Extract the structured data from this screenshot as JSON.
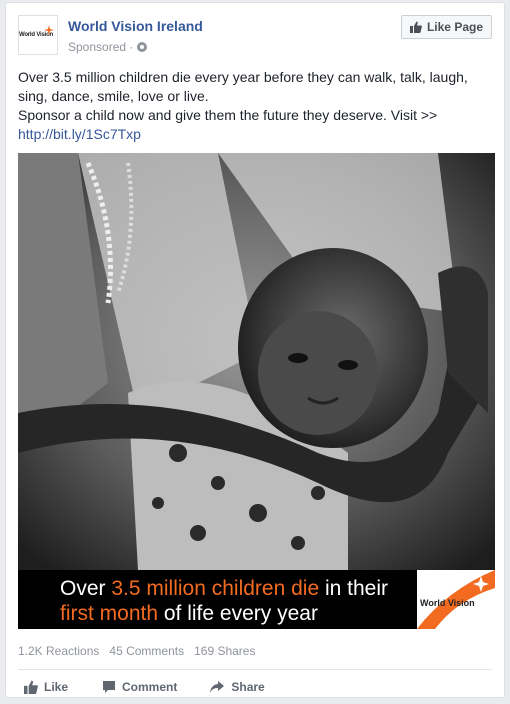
{
  "post": {
    "page_name": "World Vision Ireland",
    "sponsored": "Sponsored ·",
    "like_page": "Like Page",
    "text_lines": [
      "Over 3.5 million children die every year before they can walk, talk, laugh,",
      "sing, dance, smile, love or live.",
      "Sponsor a child now and give them the future they deserve. Visit >>"
    ],
    "link": "http://bit.ly/1Sc7Txp",
    "logo_text": "World Vision"
  },
  "image": {
    "banner_line1_a": "Over ",
    "banner_line1_hl": "3.5 million children die",
    "banner_line1_b": " in their",
    "banner_line2_hl": "first month",
    "banner_line2_b": " of life  every year",
    "brand": "World Vision"
  },
  "stats": {
    "reactions": "1.2K Reactions",
    "comments": "45 Comments",
    "shares": "169 Shares"
  },
  "actions": {
    "like": "Like",
    "comment": "Comment",
    "share": "Share"
  },
  "colors": {
    "brand_orange": "#f26b21",
    "link_blue": "#365899"
  }
}
